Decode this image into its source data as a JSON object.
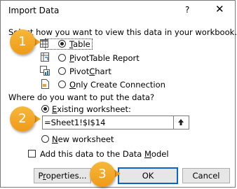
{
  "dialog": {
    "title": "Import Data",
    "help_glyph": "?",
    "close_glyph": "✕"
  },
  "view_section": {
    "prompt": "Select how you want to view this data in your workbook.",
    "options": [
      {
        "label": "Table",
        "access_key": "T",
        "rest": "able",
        "icon": "table-icon",
        "selected": true
      },
      {
        "label": "PivotTable Report",
        "access_key": "P",
        "rest": "ivotTable Report",
        "icon": "pivottable-icon",
        "selected": false
      },
      {
        "label": "PivotChart",
        "pre": "Pivot",
        "access_key": "C",
        "rest": "hart",
        "icon": "pivotchart-icon",
        "selected": false
      },
      {
        "label": "Only Create Connection",
        "access_key": "O",
        "rest": "nly Create Connection",
        "icon": "connection-icon",
        "selected": false
      }
    ]
  },
  "location_section": {
    "prompt": "Where do you want to put the data?",
    "existing_worksheet": {
      "label": "Existing worksheet:",
      "access_key": "E",
      "rest": "xisting worksheet:",
      "selected": true
    },
    "reference_value": "=Sheet1!$I$14",
    "new_worksheet": {
      "label": "New worksheet",
      "access_key": "N",
      "rest": "ew worksheet",
      "selected": false
    }
  },
  "data_model": {
    "label": "Add this data to the Data Model",
    "access_key": "M",
    "pre": "Add this data to the Data ",
    "rest": "odel",
    "checked": false
  },
  "buttons": {
    "properties": {
      "pre": "P",
      "access_key": "r",
      "rest": "operties...",
      "label": "Properties..."
    },
    "ok": "OK",
    "cancel": "Cancel"
  },
  "badges": [
    "1",
    "2",
    "3"
  ],
  "colors": {
    "badge": "#f0a21e",
    "default_button_border": "#0a64c8"
  }
}
